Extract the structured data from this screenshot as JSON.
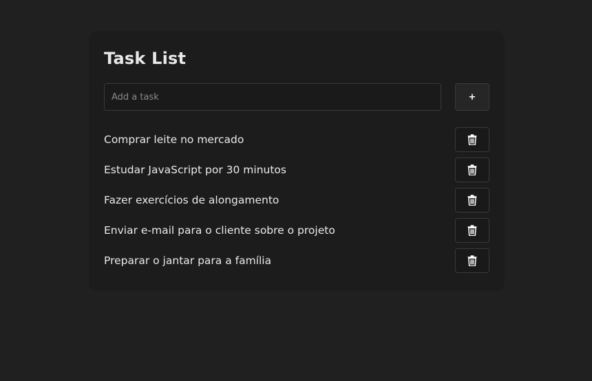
{
  "app": {
    "title": "Task List"
  },
  "add_form": {
    "input_value": "",
    "input_placeholder": "Add a task",
    "add_button_label": "+"
  },
  "tasks": [
    {
      "text": "Comprar leite no mercado",
      "delete_icon": "trash-icon"
    },
    {
      "text": "Estudar JavaScript por 30 minutos",
      "delete_icon": "trash-icon"
    },
    {
      "text": "Fazer exercícios de alongamento",
      "delete_icon": "trash-icon"
    },
    {
      "text": "Enviar e-mail para o cliente sobre o projeto",
      "delete_icon": "trash-icon"
    },
    {
      "text": "Preparar o jantar para a família",
      "delete_icon": "trash-icon"
    }
  ],
  "colors": {
    "background": "#202020",
    "card": "#1c1c1c",
    "border": "#3a3a3a",
    "text": "#eaeaea"
  }
}
